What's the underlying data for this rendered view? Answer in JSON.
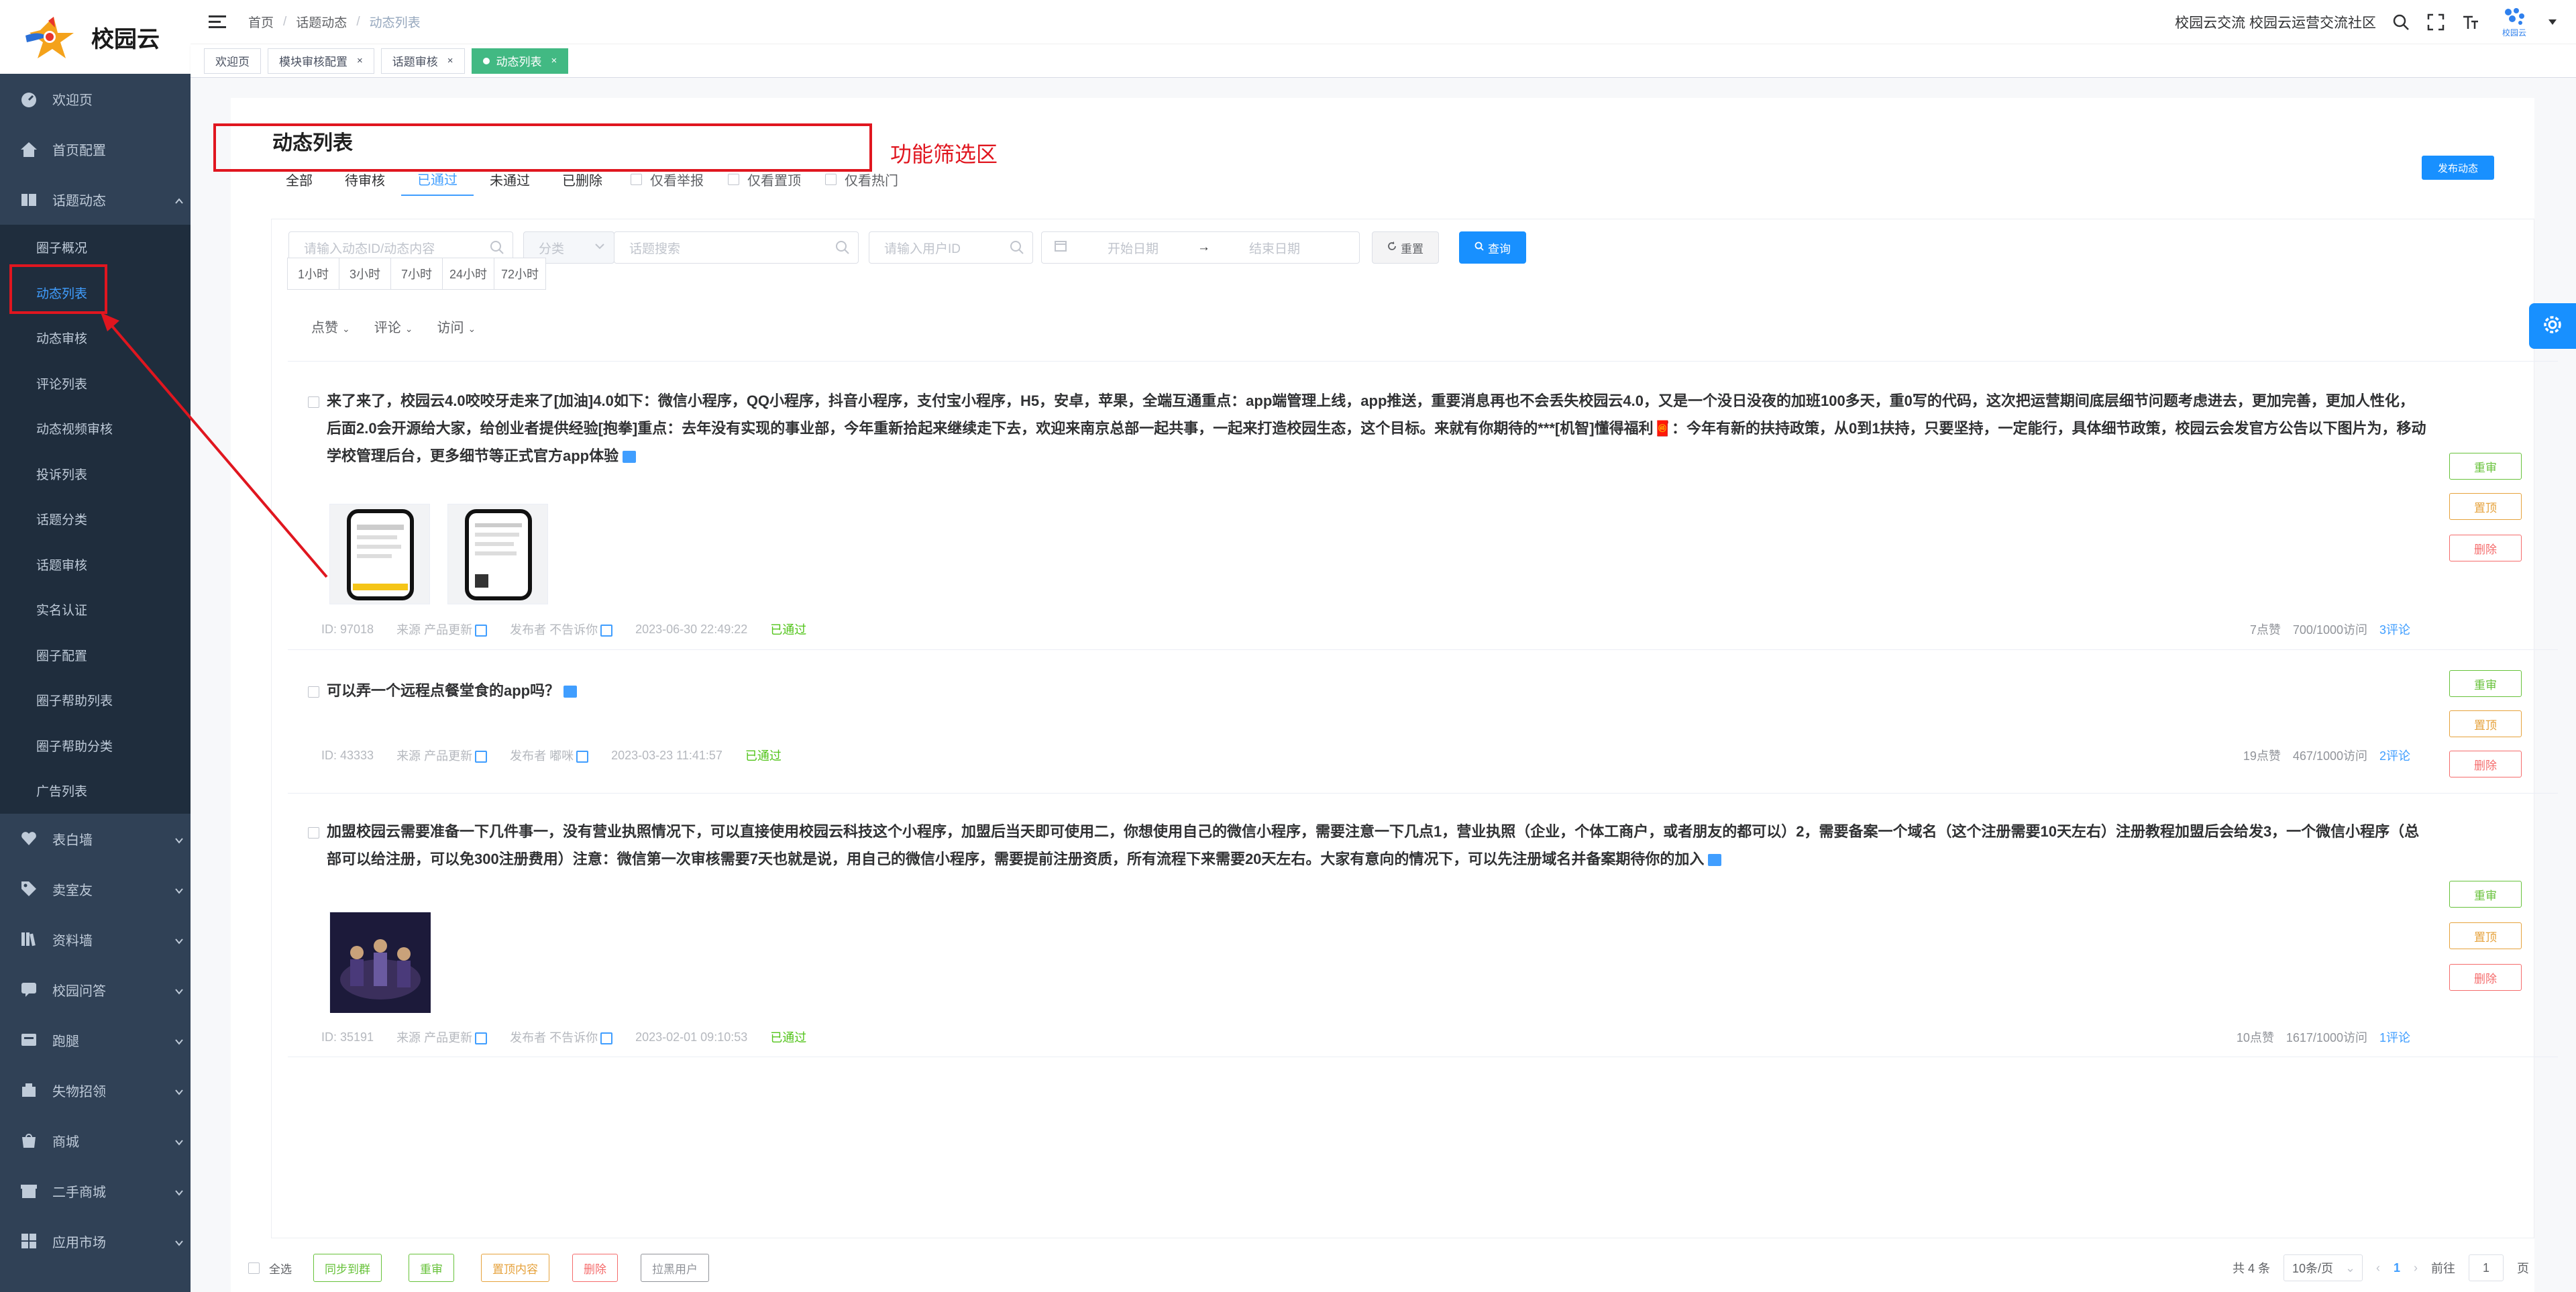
{
  "app": {
    "logo_text": "校园云"
  },
  "sidebar": {
    "items": [
      {
        "label": "欢迎页",
        "icon": "dashboard-icon"
      },
      {
        "label": "首页配置",
        "icon": "home-icon"
      },
      {
        "label": "话题动态",
        "icon": "book-icon"
      }
    ],
    "sub_items": [
      {
        "label": "圈子概况"
      },
      {
        "label": "动态列表"
      },
      {
        "label": "动态审核"
      },
      {
        "label": "评论列表"
      },
      {
        "label": "动态视频审核"
      },
      {
        "label": "投诉列表"
      },
      {
        "label": "话题分类"
      },
      {
        "label": "话题审核"
      },
      {
        "label": "实名认证"
      },
      {
        "label": "圈子配置"
      },
      {
        "label": "圈子帮助列表"
      },
      {
        "label": "圈子帮助分类"
      },
      {
        "label": "广告列表"
      }
    ],
    "lower_items": [
      {
        "label": "表白墙",
        "icon": "heart-icon"
      },
      {
        "label": "卖室友",
        "icon": "tag-icon"
      },
      {
        "label": "资料墙",
        "icon": "library-icon"
      },
      {
        "label": "校园问答",
        "icon": "qa-icon"
      },
      {
        "label": "跑腿",
        "icon": "run-icon"
      },
      {
        "label": "失物招领",
        "icon": "lost-icon"
      },
      {
        "label": "商城",
        "icon": "shop-icon"
      },
      {
        "label": "二手商城",
        "icon": "store-icon"
      },
      {
        "label": "应用市场",
        "icon": "apps-icon"
      }
    ]
  },
  "header": {
    "breadcrumb": [
      "首页",
      "话题动态",
      "动态列表"
    ],
    "site_name": "校园云交流 校园云运营交流社区",
    "avatar_label": "校园云"
  },
  "tags": [
    {
      "label": "欢迎页"
    },
    {
      "label": "模块审核配置"
    },
    {
      "label": "话题审核"
    },
    {
      "label": "动态列表"
    }
  ],
  "page": {
    "title": "动态列表",
    "filter_tabs": [
      "全部",
      "待审核",
      "已通过",
      "未通过",
      "已删除"
    ],
    "filter_checks": [
      "仅看举报",
      "仅看置顶",
      "仅看热门"
    ],
    "annotation": "功能筛选区",
    "publish_label": "发布动态"
  },
  "search": {
    "content_placeholder": "请输入动态ID/动态内容",
    "category_placeholder": "分类",
    "topic_placeholder": "话题搜索",
    "user_placeholder": "请输入用户ID",
    "start_placeholder": "开始日期",
    "date_sep": "→",
    "end_placeholder": "结束日期",
    "reset_label": "重置",
    "query_label": "查询"
  },
  "time_filters": [
    "1小时",
    "3小时",
    "7小时",
    "24小时",
    "72小时"
  ],
  "sorts": [
    "点赞",
    "评论",
    "访问"
  ],
  "posts": [
    {
      "text": "来了来了，校园云4.0咬咬牙走来了[加油]4.0如下：微信小程序，QQ小程序，抖音小程序，支付宝小程序，H5，安卓，苹果，全端互通重点：app端管理上线，app推送，重要消息再也不会丢失校园云4.0，又是一个没日没夜的加班100多天，重0写的代码，这次把运营期间底层细节问题考虑进去，更加完善，更加人性化，后面2.0会开源给大家，给创业者提供经验[抱拳]重点：去年没有实现的事业部，今年重新拾起来继续走下去，欢迎来南京总部一起共事，一起来打造校园生态，这个目标。来就有你期待的***[机智]懂得福利🧧：今年有新的扶持政策，从0到1扶持，只要坚持，一定能行，具体细节政策，校园云会发官方公告以下图片为，移动学校管理后台，更多细节等正式官方app体验",
      "id": "ID: 97018",
      "source": "来源 产品更新",
      "author": "发布者 不告诉你",
      "time": "2023-06-30 22:49:22",
      "status": "已通过",
      "likes": "7点赞",
      "visits": "700/1000访问",
      "comments": "3评论"
    },
    {
      "text": "可以弄一个远程点餐堂食的app吗？",
      "id": "ID: 43333",
      "source": "来源 产品更新",
      "author": "发布者 嘟咪",
      "time": "2023-03-23 11:41:57",
      "status": "已通过",
      "likes": "19点赞",
      "visits": "467/1000访问",
      "comments": "2评论"
    },
    {
      "text": "加盟校园云需要准备一下几件事一，没有营业执照情况下，可以直接使用校园云科技这个小程序，加盟后当天即可使用二，你想使用自己的微信小程序，需要注意一下几点1，营业执照（企业，个体工商户，或者朋友的都可以）2，需要备案一个域名（这个注册需要10天左右）注册教程加盟后会给发3，一个微信小程序（总部可以给注册，可以免300注册费用）注意：微信第一次审核需要7天也就是说，用自己的微信小程序，需要提前注册资质，所有流程下来需要20天左右。大家有意向的情况下，可以先注册域名并备案期待你的加入",
      "id": "ID: 35191",
      "source": "来源 产品更新",
      "author": "发布者 不告诉你",
      "time": "2023-02-01 09:10:53",
      "status": "已通过",
      "likes": "10点赞",
      "visits": "1617/1000访问",
      "comments": "1评论"
    }
  ],
  "post_actions": {
    "review": "重审",
    "pin": "置顶",
    "delete": "删除"
  },
  "bottom": {
    "select_all": "全选",
    "sync_label": "同步到群",
    "review_label": "重审",
    "pin_label": "置顶内容",
    "delete_label": "删除",
    "blacklist_label": "拉黑用户",
    "total": "共 4 条",
    "page_size": "10条/页",
    "current_page": "1",
    "goto_label": "前往",
    "goto_value": "1",
    "page_unit": "页"
  },
  "colors": {
    "sidebar_bg": "#304156",
    "accent": "#1890ff",
    "highlight": "#e0161f",
    "success": "#42b983"
  }
}
